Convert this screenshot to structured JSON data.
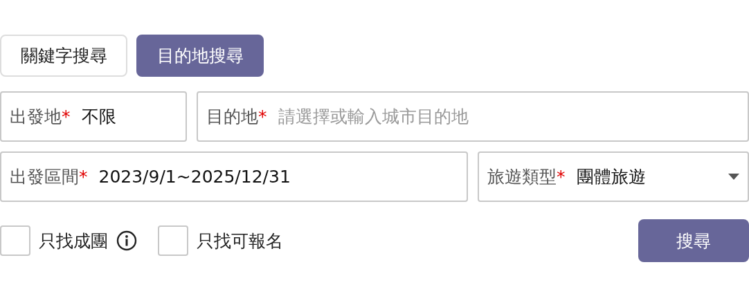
{
  "tabs": [
    {
      "label": "關鍵字搜尋",
      "selected": false
    },
    {
      "label": "目的地搜尋",
      "selected": true
    }
  ],
  "field_rows": [
    [
      {
        "kind": "text",
        "label": "出發地",
        "required_mark": "*",
        "value": "不限"
      },
      {
        "kind": "text",
        "label": "目的地",
        "required_mark": "*",
        "placeholder": "請選擇或輸入城市目的地"
      }
    ],
    [
      {
        "kind": "text",
        "label": "出發區間",
        "required_mark": "*",
        "value": "2023/9/1~2025/12/31"
      },
      {
        "kind": "select",
        "label": "旅遊類型",
        "required_mark": "*",
        "value": "團體旅遊"
      }
    ]
  ],
  "filters": [
    {
      "label": "只找成團",
      "checked": false,
      "info": true
    },
    {
      "label": "只找可報名",
      "checked": false,
      "info": false
    }
  ],
  "search_button": "搜尋"
}
